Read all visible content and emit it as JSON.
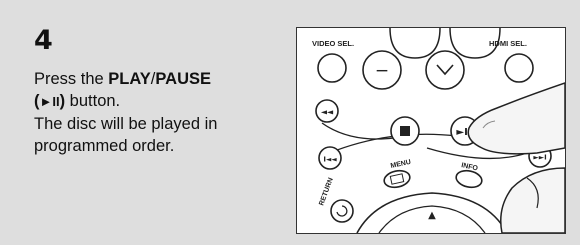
{
  "step": {
    "number": "4"
  },
  "instruction": {
    "line1_pre": "Press the ",
    "line1_play": "PLAY",
    "line1_slash": "/",
    "line1_pause": "PAUSE",
    "line2_open": "(",
    "line2_symbol": "►II",
    "line2_close": ")",
    "line2_rest": " button.",
    "line3": "The disc will be played in",
    "line4": "programmed order."
  },
  "remote": {
    "video_sel_label": "VIDEO SEL.",
    "hdmi_sel_label": "HDMI SEL.",
    "menu_label": "MENU",
    "info_label": "INFO",
    "return_label": "RETURN",
    "play_pause_symbol": "►II",
    "stop_symbol": "■",
    "prev_symbol": "I◄◄",
    "next_symbol": "►►I",
    "rewind_symbol": "◄◄",
    "up_symbol": "▲",
    "minus_symbol": "−",
    "down_symbol": "∨"
  }
}
